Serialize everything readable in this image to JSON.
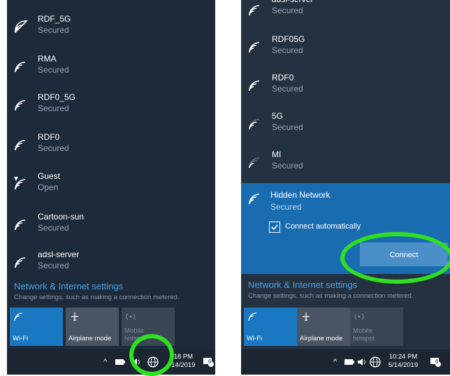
{
  "left": {
    "networks": [
      {
        "name": "RDF_5G",
        "status": "Secured",
        "icon": "wifi-icon"
      },
      {
        "name": "RMA",
        "status": "Secured",
        "icon": "wifi-icon"
      },
      {
        "name": "RDF0_5G",
        "status": "Secured",
        "icon": "wifi-icon"
      },
      {
        "name": "RDF0",
        "status": "Secured",
        "icon": "wifi-icon"
      },
      {
        "name": "Guest",
        "status": "Open",
        "icon": "wifi-open-warning-icon"
      },
      {
        "name": "Cartoon-sun",
        "status": "Secured",
        "icon": "wifi-icon"
      },
      {
        "name": "adsl-server",
        "status": "Secured",
        "icon": "wifi-icon"
      }
    ],
    "settings_title": "Network & Internet settings",
    "settings_desc": "Change settings, such as making a connection metered.",
    "tiles": {
      "wifi": "Wi-Fi",
      "airplane": "Airplane mode",
      "mobile": "Mobile",
      "hotspot": "hotspot"
    },
    "clock_time": ":18 PM",
    "clock_date": "/14/2019",
    "notif_count": "6"
  },
  "right": {
    "networks": [
      {
        "name": "adsl-server",
        "status": "Secured",
        "icon": "wifi-icon"
      },
      {
        "name": "RDF05G",
        "status": "Secured",
        "icon": "wifi-icon"
      },
      {
        "name": "RDF0",
        "status": "Secured",
        "icon": "wifi-icon"
      },
      {
        "name": "5G",
        "status": "Secured",
        "icon": "wifi-weak-icon"
      },
      {
        "name": "MI",
        "status": "Secured",
        "icon": "wifi-weak-icon"
      }
    ],
    "hidden": {
      "name": "Hidden Network",
      "status": "Secured",
      "auto_label": "Connect automatically",
      "connect_label": "Connect"
    },
    "settings_title": "Network & Internet settings",
    "settings_desc": "Change settings, such as making a connection metered.",
    "tiles": {
      "wifi": "Wi-Fi",
      "airplane": "Airplane mode",
      "mobile": "Mobile",
      "hotspot": "hotspot"
    },
    "clock_time": "10:24 PM",
    "clock_date": "5/14/2019",
    "notif_count": "6"
  },
  "colors": {
    "accent": "#1a78c2",
    "highlight_ring": "#2fe020",
    "panel_bg": "#1c2a3a"
  }
}
